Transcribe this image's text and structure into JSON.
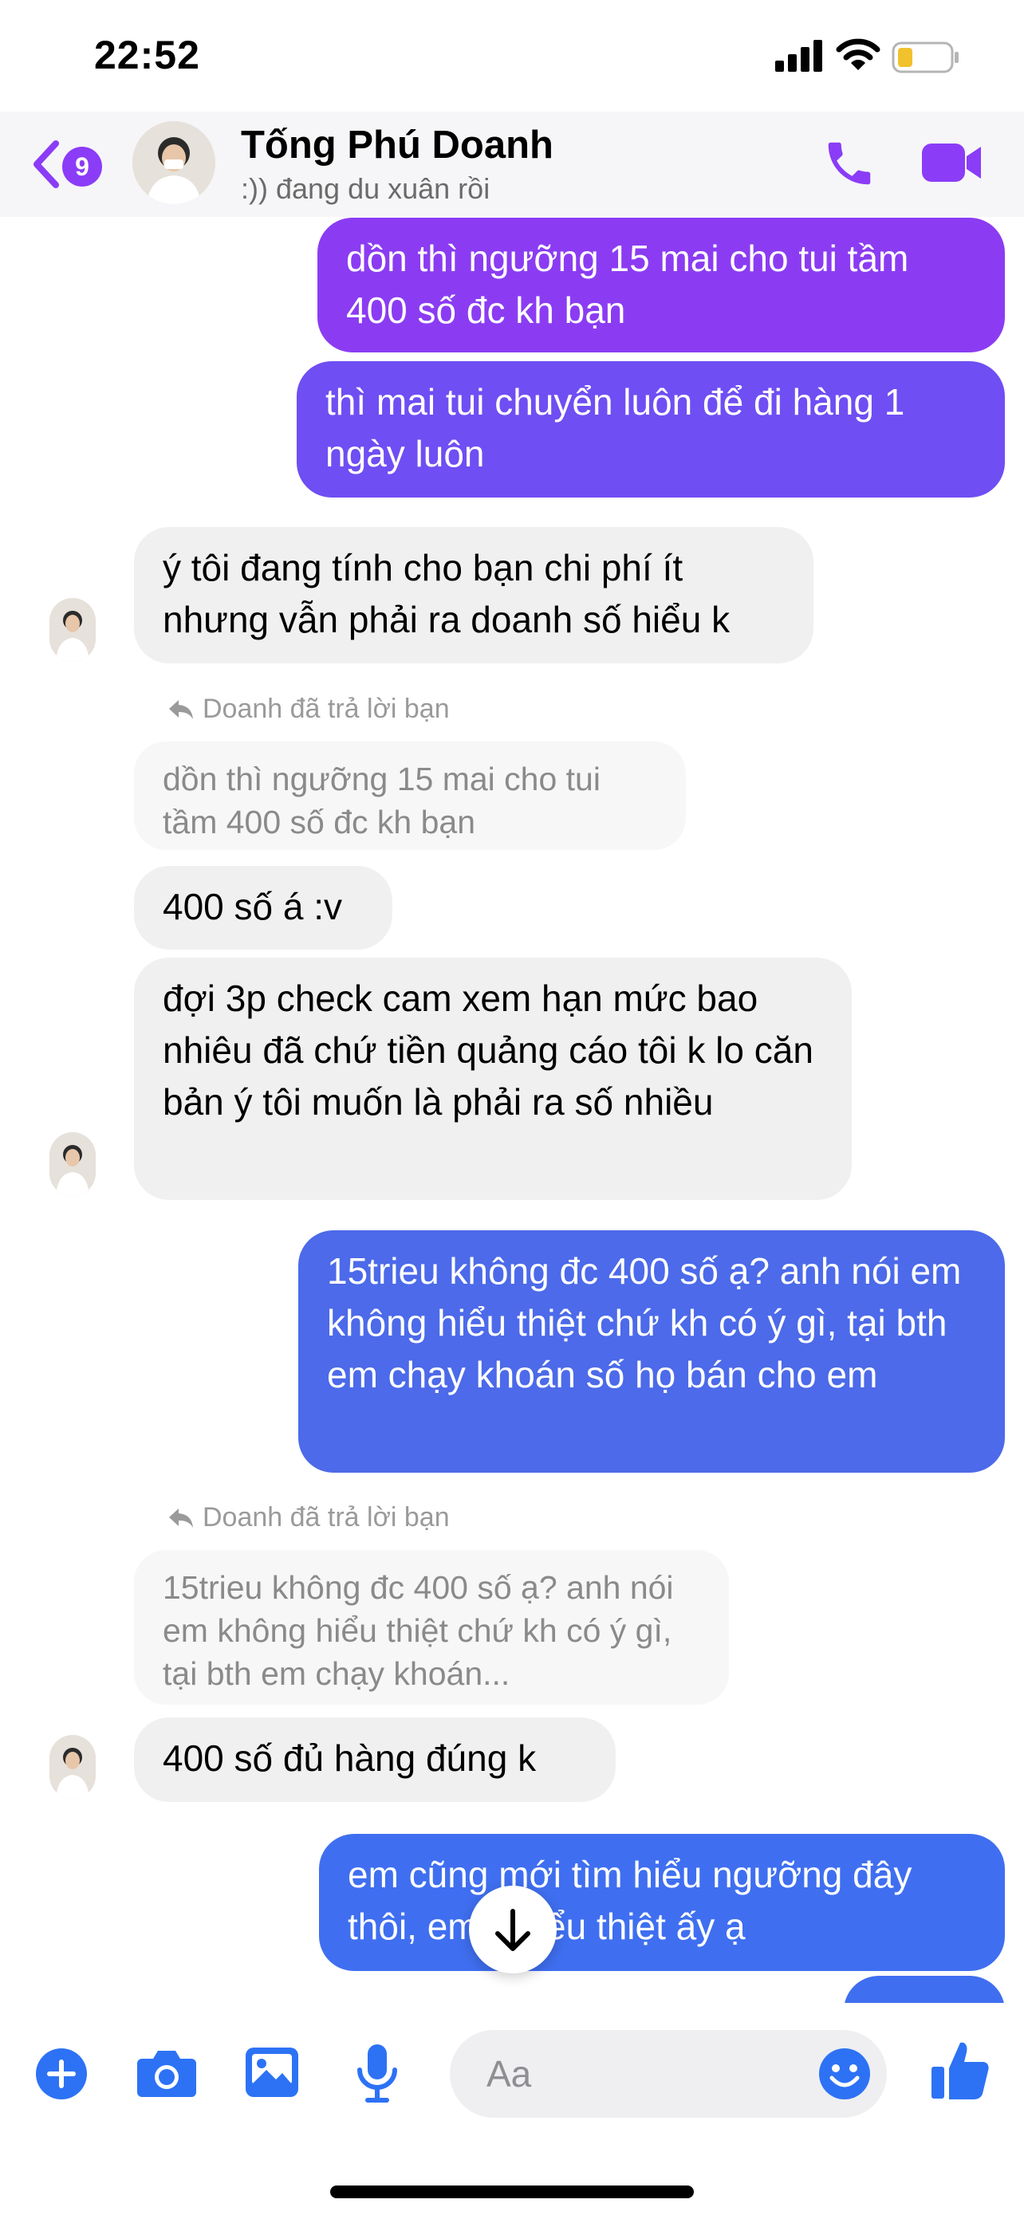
{
  "status_bar": {
    "time": "22:52"
  },
  "header": {
    "back_badge": "9",
    "contact_name": "Tống Phú Doanh",
    "contact_status": ":)) đang du xuân rồi"
  },
  "messages": [
    {
      "text": "dồn thì ngưỡng 15 mai cho tui tầm 400 số đc kh bạn"
    },
    {
      "text": "thì mai tui chuyển luôn để đi hàng 1 ngày luôn"
    },
    {
      "text": "ý tôi đang tính cho bạn chi phí ít nhưng vẫn phải ra doanh số hiểu k"
    },
    {
      "reply_label": "Doanh đã trả lời bạn",
      "quote": "dồn thì ngưỡng 15 mai cho tui tầm 400 số đc kh bạn",
      "text": "400 số á :v"
    },
    {
      "text": "đợi 3p check cam xem hạn mức bao nhiêu đã chứ tiền quảng cáo tôi k lo căn bản ý tôi muốn là phải ra số nhiều"
    },
    {
      "text": "15trieu không đc 400 số ạ? anh nói em không hiểu thiệt chứ kh có ý gì, tại bth em chạy khoán số họ bán cho em"
    },
    {
      "reply_label": "Doanh đã trả lời bạn",
      "quote": "15trieu không đc 400 số ạ? anh nói em không hiểu thiệt chứ kh có ý gì, tại bth em chạy khoán...",
      "text": "400 số đủ hàng đúng k"
    },
    {
      "text": "em cũng mới tìm hiểu ngưỡng đây thôi, em k hiểu thiệt ấy ạ"
    }
  ],
  "composer": {
    "placeholder": "Aa"
  },
  "colors": {
    "accent": "#8b3cf7",
    "blue": "#3f6ff0",
    "composer_icon": "#2d72f5"
  }
}
